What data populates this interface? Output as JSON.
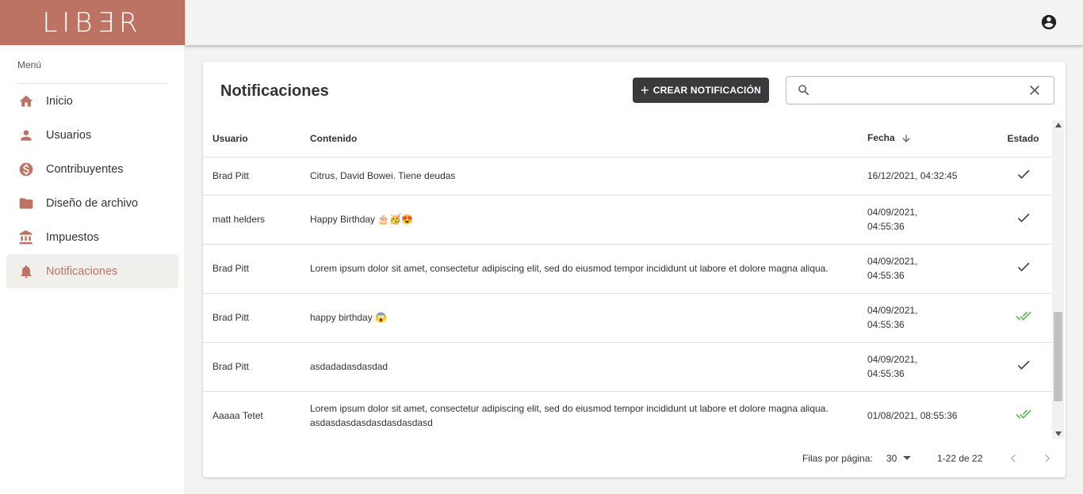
{
  "brand": {
    "logo_text": "LIBƎR",
    "color": "#bd7363"
  },
  "sidebar": {
    "menu_label": "Menú",
    "items": [
      {
        "label": "Inicio",
        "icon": "home-icon",
        "active": false
      },
      {
        "label": "Usuarios",
        "icon": "person-icon",
        "active": false
      },
      {
        "label": "Contribuyentes",
        "icon": "dollar-icon",
        "active": false
      },
      {
        "label": "Diseño de archivo",
        "icon": "folder-icon",
        "active": false
      },
      {
        "label": "Impuestos",
        "icon": "bank-icon",
        "active": false
      },
      {
        "label": "Notificaciones",
        "icon": "bell-icon",
        "active": true
      }
    ]
  },
  "topbar": {
    "account_icon": "account-circle-icon"
  },
  "main": {
    "title": "Notificaciones",
    "create_button": "CREAR NOTIFICACIÓN",
    "search": {
      "value": "",
      "placeholder": ""
    },
    "table": {
      "columns": {
        "user": "Usuario",
        "content": "Contenido",
        "date": "Fecha",
        "status": "Estado"
      },
      "rows": [
        {
          "user": "Brad Pitt",
          "content": "Citrus, David Bowei. Tiene deudas",
          "date": "16/12/2021, 04:32:45",
          "status": "sent"
        },
        {
          "user": "matt helders",
          "content": "Happy Birthday 🎂🥳😍",
          "date": "04/09/2021,\n04:55:36",
          "status": "sent"
        },
        {
          "user": "Brad Pitt",
          "content": "Lorem ipsum dolor sit amet, consectetur adipiscing elit, sed do eiusmod tempor incididunt ut labore et dolore magna aliqua.",
          "date": "04/09/2021,\n04:55:36",
          "status": "sent"
        },
        {
          "user": "Brad Pitt",
          "content": "happy birthday 😱",
          "date": "04/09/2021,\n04:55:36",
          "status": "read"
        },
        {
          "user": "Brad Pitt",
          "content": "asdadadasdasdad",
          "date": "04/09/2021,\n04:55:36",
          "status": "sent"
        },
        {
          "user": "Aaaaa Tetet",
          "content": "Lorem ipsum dolor sit amet, consectetur adipiscing elit, sed do eiusmod tempor incididunt ut labore et dolore magna aliqua. asdasdasdasdasdasdasdasd",
          "date": "01/08/2021, 08:55:36",
          "status": "read"
        }
      ]
    },
    "pagination": {
      "rows_label": "Filas por página:",
      "rows_value": "30",
      "range": "1-22 de 22"
    }
  },
  "colors": {
    "accent": "#bd7363",
    "read_check": "#5cb85c",
    "button_dark": "#3a3a3c"
  }
}
